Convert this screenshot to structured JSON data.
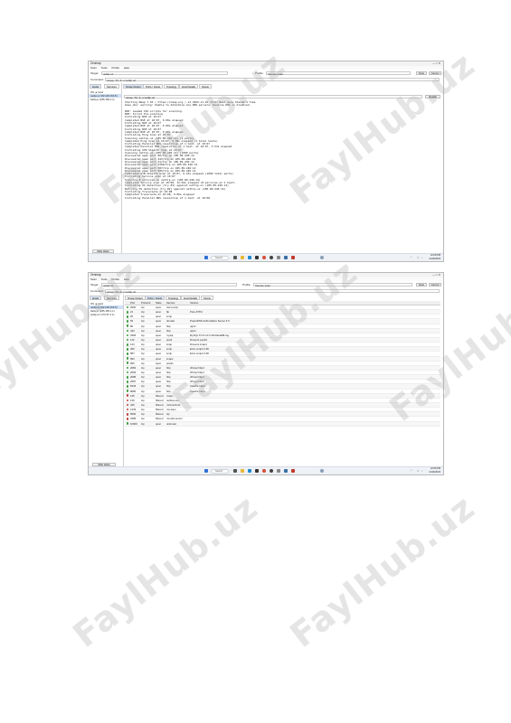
{
  "screenshot1": {
    "app_title": "Zenmap",
    "menu": [
      "Scan",
      "Tools",
      "Profile",
      "Help"
    ],
    "target_label": "Target:",
    "target_value": "nettip.uz",
    "profile_label": "Profile:",
    "profile_value": "Intense scan",
    "scan_button": "Scan",
    "cancel_button": "Cancel",
    "command_label": "Command:",
    "command_value": "nmap -T4 -A -v nettip.uz",
    "sidebar_tabs": [
      "Hosts",
      "Services"
    ],
    "os_host_header": "OS ▲ Host",
    "hosts": [
      "nettip.uz (82.148.153.5)",
      "bahuyo (185.165.1.1)"
    ],
    "filter_hosts_button": "Filter Hosts",
    "result_tabs": [
      "Nmap Output",
      "Ports / Hosts",
      "Topology",
      "Host Details",
      "Scans"
    ],
    "output_command": "nmap -T4 -A -v nettip.uz",
    "details_button": "Details",
    "output_lines": [
      "Starting Nmap 7.93 ( https://nmap.org ) at 2023-11-16 10:07 West Asia Standard Time",
      "mass_dns: warning: Unable to determine any DNS servers. Reverse DNS is disabled.",
      "",
      "NSE: Loaded 156 scripts for scanning.",
      "NSE: Script Pre-scanning.",
      "Initiating NSE at 10:07",
      "Completed NSE at 10:07, 0.00s elapsed",
      "Initiating NSE at 10:07",
      "Completed NSE at 10:07, 0.00s elapsed",
      "Initiating NSE at 10:07",
      "Completed NSE at 10:07, 0.00s elapsed",
      "Initiating Ping Scan at 10:07",
      "Scanning nettip.uz (185.89.240.14) [4 ports]",
      "Completed Ping Scan at 10:07, 0.09s elapsed (1 total hosts)",
      "Initiating Parallel DNS resolution of 1 host. at 10:07",
      "Completed Parallel DNS resolution of 1 host. at 10:07, 5.53s elapsed",
      "Initiating SYN Stealth Scan at 10:07",
      "Scanning nettip.uz (185.89.240.14) [1000 ports]",
      "Discovered open port 80/tcp on 185.89.240.14",
      "Discovered open port 443/tcp on 185.89.240.14",
      "Discovered open port 21/tcp on 185.89.240.14",
      "Discovered open port 3306/tcp on 185.89.240.14",
      "Discovered open port 587/tcp on 185.89.240.14",
      "Discovered open port 995/tcp on 185.89.240.14",
      "Completed SYN Stealth Scan at 10:07, 6.23s elapsed (1000 total ports)",
      "Initiating Service scan at 10:07",
      "Scanning 8 services on nettip.uz (185.89.240.14)",
      "Completed Service scan at 10:08, 12.02s elapsed (8 services on 1 host)",
      "Initiating OS detection (try #1) against nettip.uz (185.89.240.14)",
      "Retrying OS detection (try #2) against nettip.uz (185.89.240.14)",
      "Initiating Traceroute at 10:08",
      "Completed Traceroute at 10:08, 0.06s elapsed",
      "Initiating Parallel DNS resolution of 1 host. at 10:08"
    ],
    "taskbar_search": "Search",
    "tray_time": "10:08 PM",
    "tray_date": "11/16/2023"
  },
  "screenshot2": {
    "app_title": "Zenmap",
    "menu": [
      "Scan",
      "Tools",
      "Profile",
      "Help"
    ],
    "target_label": "Target:",
    "target_value": "nettip.uz",
    "profile_label": "Profile:",
    "profile_value": "Intense scan",
    "scan_button": "Scan",
    "cancel_button": "Cancel",
    "command_label": "Command:",
    "command_value": "nmap -T4 -A -v nettip.uz",
    "sidebar_tabs": [
      "Hosts",
      "Services"
    ],
    "os_host_header": "OS ▲ Host",
    "hosts": [
      "nettip.uz (82.148.153.5)",
      "bahuyo (185.165.1.1)",
      "nettip.uz (172.67.1.1)"
    ],
    "filter_hosts_button": "Filter Hosts",
    "result_tabs": [
      "Nmap Output",
      "Ports / Hosts",
      "Topology",
      "Host Details",
      "Scans"
    ],
    "columns": [
      "Port",
      "Protocol",
      "State",
      "Service",
      "Version"
    ],
    "ports": [
      {
        "port": "2000",
        "protocol": "tcp",
        "state": "open",
        "service": "cisco-sccp",
        "version": "",
        "status": "open"
      },
      {
        "port": "21",
        "protocol": "tcp",
        "state": "open",
        "service": "ftp",
        "version": "Pure-FTPd",
        "status": "open"
      },
      {
        "port": "25",
        "protocol": "tcp",
        "state": "open",
        "service": "smtp",
        "version": "",
        "status": "open"
      },
      {
        "port": "53",
        "protocol": "tcp",
        "state": "open",
        "service": "domain",
        "version": "PowerDNS Authoritative Server 4.5",
        "status": "open"
      },
      {
        "port": "80",
        "protocol": "tcp",
        "state": "open",
        "service": "http",
        "version": "nginx",
        "status": "open"
      },
      {
        "port": "443",
        "protocol": "tcp",
        "state": "open",
        "service": "http",
        "version": "nginx",
        "status": "open"
      },
      {
        "port": "3306",
        "protocol": "tcp",
        "state": "open",
        "service": "mysql",
        "version": "MySQL 5.5.5-10.3.39-MariaDB-log",
        "status": "open"
      },
      {
        "port": "110",
        "protocol": "tcp",
        "state": "open",
        "service": "pop3",
        "version": "Dovecot pop3d",
        "status": "open"
      },
      {
        "port": "143",
        "protocol": "tcp",
        "state": "open",
        "service": "imap",
        "version": "Dovecot imapd",
        "status": "open"
      },
      {
        "port": "465",
        "protocol": "tcp",
        "state": "open",
        "service": "smtp",
        "version": "Exim smtpd 4.96",
        "status": "open"
      },
      {
        "port": "587",
        "protocol": "tcp",
        "state": "open",
        "service": "smtp",
        "version": "Exim smtpd 4.96",
        "status": "open"
      },
      {
        "port": "993",
        "protocol": "tcp",
        "state": "open",
        "service": "imaps",
        "version": "",
        "status": "open"
      },
      {
        "port": "995",
        "protocol": "tcp",
        "state": "open",
        "service": "pop3s",
        "version": "",
        "status": "open"
      },
      {
        "port": "2082",
        "protocol": "tcp",
        "state": "open",
        "service": "http",
        "version": "cPanel httpd",
        "status": "open"
      },
      {
        "port": "2083",
        "protocol": "tcp",
        "state": "open",
        "service": "http",
        "version": "cPanel httpd",
        "status": "open"
      },
      {
        "port": "2086",
        "protocol": "tcp",
        "state": "open",
        "service": "http",
        "version": "cPanel httpd",
        "status": "open"
      },
      {
        "port": "2087",
        "protocol": "tcp",
        "state": "open",
        "service": "http",
        "version": "cPanel httpd",
        "status": "open"
      },
      {
        "port": "8443",
        "protocol": "tcp",
        "state": "open",
        "service": "http",
        "version": "Apache httpd",
        "status": "open"
      },
      {
        "port": "8080",
        "protocol": "tcp",
        "state": "open",
        "service": "http",
        "version": "Apache httpd",
        "status": "open"
      },
      {
        "port": "135",
        "protocol": "tcp",
        "state": "filtered",
        "service": "msrpc",
        "version": "",
        "status": "filtered"
      },
      {
        "port": "139",
        "protocol": "tcp",
        "state": "filtered",
        "service": "netbios-ssn",
        "version": "",
        "status": "filtered"
      },
      {
        "port": "445",
        "protocol": "tcp",
        "state": "filtered",
        "service": "microsoft-ds",
        "version": "",
        "status": "filtered"
      },
      {
        "port": "1433",
        "protocol": "tcp",
        "state": "filtered",
        "service": "ms-sql-s",
        "version": "",
        "status": "filtered"
      },
      {
        "port": "5060",
        "protocol": "tcp",
        "state": "filtered",
        "service": "sip",
        "version": "",
        "status": "filtered"
      },
      {
        "port": "3389",
        "protocol": "tcp",
        "state": "filtered",
        "service": "ms-wbt-server",
        "version": "",
        "status": "filtered"
      },
      {
        "port": "10000",
        "protocol": "tcp",
        "state": "open",
        "service": "unknown",
        "version": "",
        "status": "open"
      }
    ],
    "taskbar_search": "Search",
    "tray_time": "10:09 PM",
    "tray_date": "11/16/2023"
  },
  "watermark": "FaylHub.uz",
  "colors": {
    "open": "#3c9a3c",
    "filtered": "#c23b3b",
    "accent": "#2e6fd6"
  }
}
